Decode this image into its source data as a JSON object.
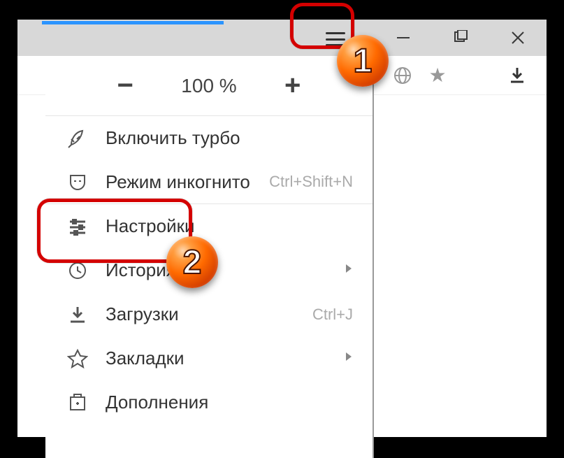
{
  "window": {
    "minimize": "—",
    "maximize": "▢",
    "close": "✕"
  },
  "zoom": {
    "minus": "−",
    "value": "100 %",
    "plus": "+"
  },
  "menu": {
    "turbo": "Включить турбо",
    "incognito": "Режим инкогнито",
    "incognito_shortcut": "Ctrl+Shift+N",
    "settings": "Настройки",
    "history": "История",
    "downloads": "Загрузки",
    "downloads_shortcut": "Ctrl+J",
    "bookmarks": "Закладки",
    "addons": "Дополнения"
  },
  "badges": {
    "one": "1",
    "two": "2"
  }
}
